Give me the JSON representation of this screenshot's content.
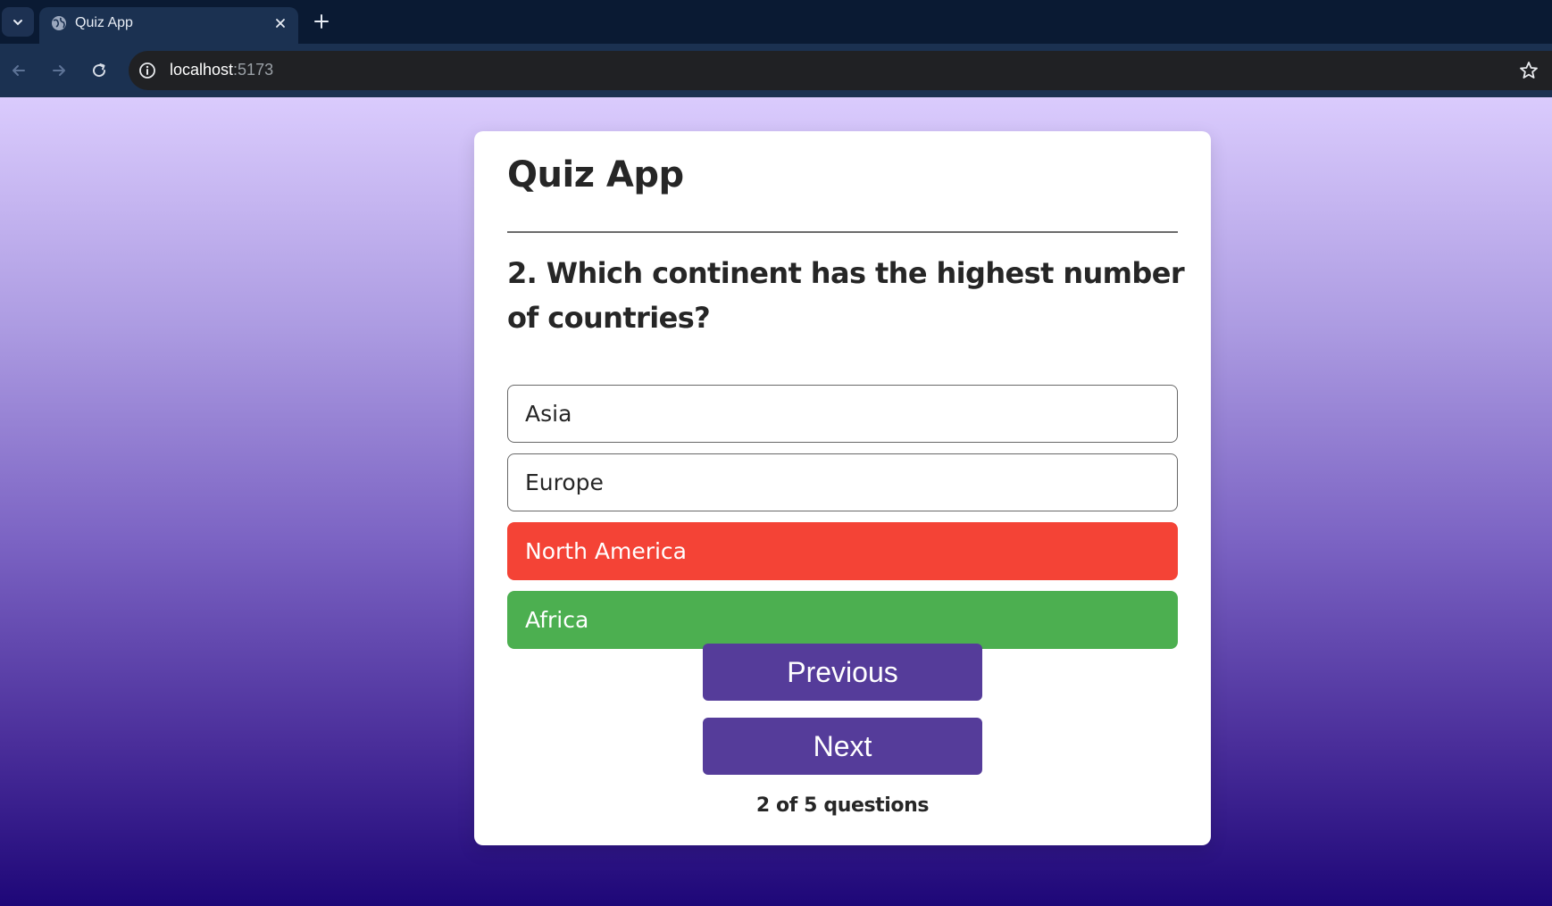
{
  "browser": {
    "tab": {
      "title": "Quiz App",
      "favicon": "globe-icon",
      "close_icon": "close-icon"
    },
    "new_tab_icon": "plus-icon",
    "address_bar": {
      "host": "localhost",
      "port": ":5173",
      "info_icon": "info-icon",
      "bookmark_icon": "star-icon"
    }
  },
  "quiz": {
    "title": "Quiz App",
    "question": "2. Which continent has the highest number of countries?",
    "options": [
      {
        "label": "Asia",
        "state": "default"
      },
      {
        "label": "Europe",
        "state": "default"
      },
      {
        "label": "North America",
        "state": "wrong"
      },
      {
        "label": "Africa",
        "state": "correct"
      }
    ],
    "buttons": {
      "previous": "Previous",
      "next": "Next"
    },
    "progress": "2 of 5 questions"
  },
  "colors": {
    "wrong": "#f44336",
    "correct": "#4caf50",
    "button": "#553c9a",
    "gradient_top": "#dacbfd",
    "gradient_bottom": "#1e0778"
  }
}
